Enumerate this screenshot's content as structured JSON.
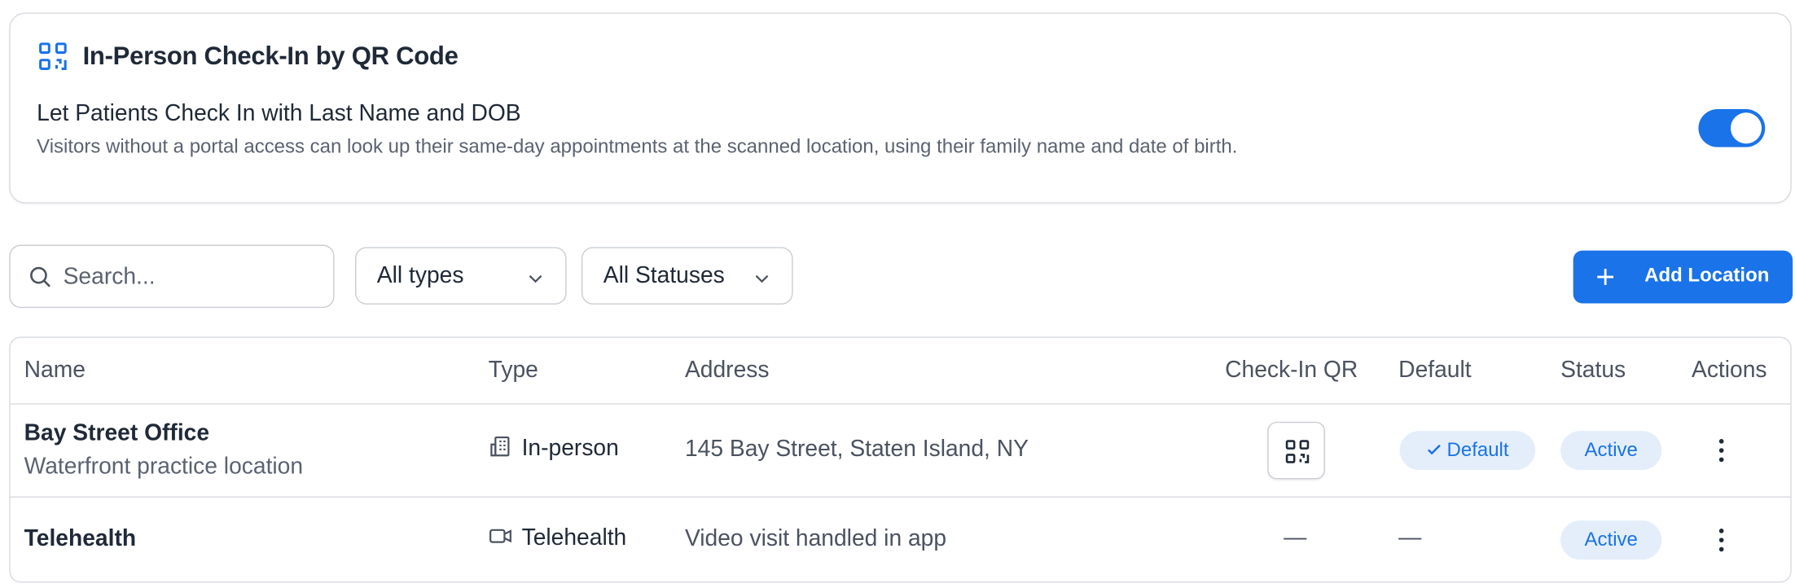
{
  "checkin_card": {
    "title": "In-Person Check-In by QR Code",
    "icon": "qr-code-icon",
    "setting_title": "Let Patients Check In with Last Name and DOB",
    "setting_description": "Visitors without a portal access can look up their same-day appointments at the scanned location, using their family name and date of birth.",
    "toggle_on": true
  },
  "toolbar": {
    "search_placeholder": "Search...",
    "type_filter": "All types",
    "status_filter": "All Statuses",
    "add_label": "Add Location"
  },
  "table": {
    "columns": [
      "Name",
      "Type",
      "Address",
      "Check-In QR",
      "Default",
      "Status",
      "Actions"
    ],
    "rows": [
      {
        "name": "Bay Street Office",
        "subtitle": "Waterfront practice location",
        "type": "In-person",
        "type_icon": "building-icon",
        "address": "145 Bay Street, Staten Island, NY",
        "checkin_qr": "qr-code-icon",
        "default": "Default",
        "status": "Active"
      },
      {
        "name": "Telehealth",
        "type": "Telehealth",
        "type_icon": "video-camera-icon",
        "address": "Video visit handled in app",
        "checkin_qr": "—",
        "default": "—",
        "status": "Active"
      }
    ]
  },
  "colors": {
    "accent": "#1a73e8",
    "badge_bg": "#e4eefb",
    "border": "#d8dbe0"
  }
}
